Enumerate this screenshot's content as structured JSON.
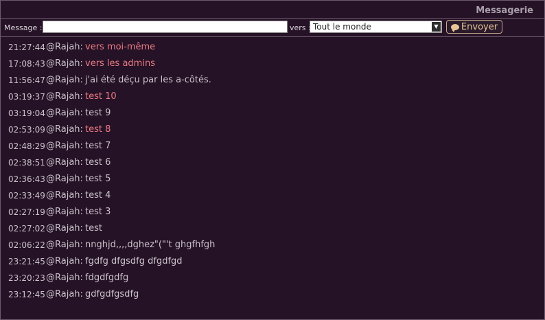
{
  "header": {
    "title": "Messagerie"
  },
  "toolbar": {
    "message_label": "Message :",
    "message_value": "",
    "to_label": "vers :",
    "to_selected": "Tout le monde",
    "send_label": "Envoyer",
    "send_icon": "speech-bubble-icon"
  },
  "colors": {
    "highlight": "#ea7c85",
    "normal": "#c9c3ca",
    "background": "#261226"
  },
  "messages": [
    {
      "time": "21:27:44",
      "user": "@Rajah:",
      "text": "vers moi-même",
      "highlight": true
    },
    {
      "time": "17:08:43",
      "user": "@Rajah:",
      "text": "vers les admins",
      "highlight": true
    },
    {
      "time": "11:56:47",
      "user": "@Rajah:",
      "text": "j'ai été déçu par les a-côtés.",
      "highlight": false
    },
    {
      "time": "03:19:37",
      "user": "@Rajah:",
      "text": "test 10",
      "highlight": true
    },
    {
      "time": "03:19:04",
      "user": "@Rajah:",
      "text": "test 9",
      "highlight": false
    },
    {
      "time": "02:53:09",
      "user": "@Rajah:",
      "text": "test 8",
      "highlight": true
    },
    {
      "time": "02:48:29",
      "user": "@Rajah:",
      "text": "test 7",
      "highlight": false
    },
    {
      "time": "02:38:51",
      "user": "@Rajah:",
      "text": "test 6",
      "highlight": false
    },
    {
      "time": "02:36:43",
      "user": "@Rajah:",
      "text": "test 5",
      "highlight": false
    },
    {
      "time": "02:33:49",
      "user": "@Rajah:",
      "text": "test 4",
      "highlight": false
    },
    {
      "time": "02:27:19",
      "user": "@Rajah:",
      "text": "test 3",
      "highlight": false
    },
    {
      "time": "02:27:02",
      "user": "@Rajah:",
      "text": "test",
      "highlight": false
    },
    {
      "time": "02:06:22",
      "user": "@Rajah:",
      "text": "nnghjd,,,,dghez\"(\"'t ghgfhfgh",
      "highlight": false
    },
    {
      "time": "23:21:45",
      "user": "@Rajah:",
      "text": "fgdfg dfgsdfg dfgdfgd",
      "highlight": false
    },
    {
      "time": "23:20:23",
      "user": "@Rajah:",
      "text": "fdgdfgdfg",
      "highlight": false
    },
    {
      "time": "23:12:45",
      "user": "@Rajah:",
      "text": "gdfgdfgsdfg",
      "highlight": false
    }
  ]
}
